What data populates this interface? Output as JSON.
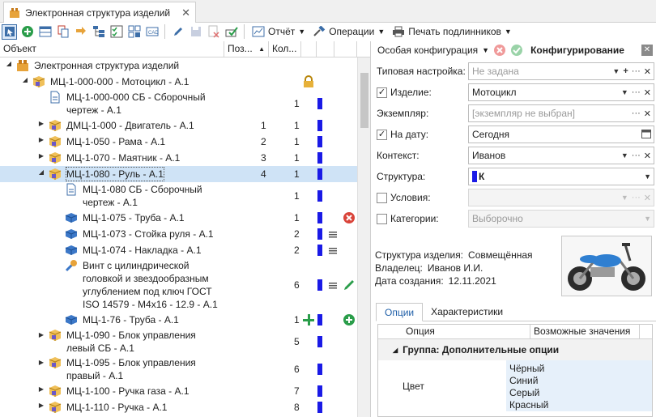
{
  "tab": {
    "title": "Электронная структура изделий",
    "close": "✕"
  },
  "toolbar": {
    "report": "Отчёт",
    "operations": "Операции",
    "print": "Печать подлинников"
  },
  "grid": {
    "col_object": "Объект",
    "col_pos": "Поз...",
    "col_qty": "Кол...",
    "rows": [
      {
        "label": "Электронная структура изделий",
        "pos": "",
        "qty": "",
        "level": 0,
        "icon": "structure",
        "exp": "down"
      },
      {
        "label": "МЦ-1-000-000 - Мотоцикл - А.1",
        "pos": "",
        "qty": "",
        "level": 1,
        "icon": "assembly",
        "exp": "down",
        "lock": true
      },
      {
        "label": "МЦ-1-000-000 СБ - Сборочный\nчертеж - А.1",
        "pos": "",
        "qty": "1",
        "level": 2,
        "icon": "document",
        "bar": true
      },
      {
        "label": "ДМЦ-1-000 - Двигатель - А.1",
        "pos": "1",
        "qty": "1",
        "level": 2,
        "icon": "assembly",
        "exp": "right",
        "bar": true
      },
      {
        "label": "МЦ-1-050 - Рама - А.1",
        "pos": "2",
        "qty": "1",
        "level": 2,
        "icon": "assembly",
        "exp": "right",
        "bar": true
      },
      {
        "label": "МЦ-1-070 - Маятник - А.1",
        "pos": "3",
        "qty": "1",
        "level": 2,
        "icon": "assembly",
        "exp": "right",
        "bar": true
      },
      {
        "label": "МЦ-1-080 - Руль - А.1",
        "pos": "4",
        "qty": "1",
        "level": 2,
        "icon": "assembly",
        "exp": "down",
        "bar": true,
        "selected": true
      },
      {
        "label": "МЦ-1-080 СБ - Сборочный\nчертеж - А.1",
        "pos": "",
        "qty": "1",
        "level": 3,
        "icon": "document",
        "bar": true
      },
      {
        "label": "МЦ-1-075 - Труба - А.1",
        "pos": "",
        "qty": "1",
        "level": 3,
        "icon": "part",
        "bar": true,
        "status": "remove"
      },
      {
        "label": "МЦ-1-073 - Стойка руля - А.1",
        "pos": "",
        "qty": "2",
        "level": 3,
        "icon": "part",
        "bar": true,
        "status": "menu"
      },
      {
        "label": "МЦ-1-074 - Накладка - А.1",
        "pos": "",
        "qty": "2",
        "level": 3,
        "icon": "part",
        "bar": true,
        "status": "menu"
      },
      {
        "label": "Винт с цилиндрической\nголовкой и звездообразным\nуглублением под ключ ГОСТ\nISO 14579 - M4x16 - 12.9 - А.1",
        "pos": "",
        "qty": "6",
        "level": 3,
        "icon": "standard",
        "bar": true,
        "status": "menu-edit"
      },
      {
        "label": "МЦ-1-76 - Труба - А.1",
        "pos": "",
        "qty": "1",
        "level": 3,
        "icon": "part",
        "bar": true,
        "plus": true,
        "status": "add"
      },
      {
        "label": "МЦ-1-090 - Блок управления\nлевый СБ - А.1",
        "pos": "",
        "qty": "5",
        "level": 2,
        "icon": "assembly",
        "exp": "right",
        "bar": true
      },
      {
        "label": "МЦ-1-095 - Блок управления\nправый - А.1",
        "pos": "",
        "qty": "6",
        "level": 2,
        "icon": "assembly",
        "exp": "right",
        "bar": true
      },
      {
        "label": "МЦ-1-100 - Ручка газа - А.1",
        "pos": "",
        "qty": "7",
        "level": 2,
        "icon": "assembly",
        "exp": "right",
        "bar": true
      },
      {
        "label": "МЦ-1-110 - Ручка - А.1",
        "pos": "",
        "qty": "8",
        "level": 2,
        "icon": "assembly",
        "exp": "right",
        "bar": true
      }
    ]
  },
  "config": {
    "special": "Особая конфигурация",
    "title": "Конфигурирование",
    "fields": [
      {
        "label": "Типовая настройка:",
        "value": "Не задана",
        "placeholder": true,
        "check": null,
        "acts": "add"
      },
      {
        "label": "Изделие:",
        "value": "Мотоцикл",
        "placeholder": false,
        "check": true,
        "acts": "dd"
      },
      {
        "label": "Экземпляр:",
        "value": "[экземпляр не выбран]",
        "placeholder": true,
        "check": null,
        "acts": "dots"
      },
      {
        "label": "На дату:",
        "value": "Сегодня",
        "placeholder": false,
        "check": true,
        "acts": "cal"
      },
      {
        "label": "Контекст:",
        "value": "Иванов",
        "placeholder": false,
        "check": null,
        "acts": "dd"
      },
      {
        "label": "Структура:",
        "value": "К",
        "placeholder": false,
        "check": null,
        "acts": "only"
      },
      {
        "label": "Условия:",
        "value": "",
        "placeholder": true,
        "check": false,
        "acts": "dd",
        "disabled": true
      },
      {
        "label": "Категории:",
        "value": "Выборочно",
        "placeholder": true,
        "check": false,
        "acts": "only",
        "disabled": true
      }
    ],
    "info": {
      "structure_label": "Структура изделия:",
      "structure": "Совмещённая",
      "owner_label": "Владелец:",
      "owner": "Иванов И.И.",
      "created_label": "Дата создания:",
      "created": "12.11.2021"
    },
    "tabs": [
      "Опции",
      "Характеристики"
    ],
    "options": {
      "col_option": "Опция",
      "col_values": "Возможные значения",
      "group": "Группа: Дополнительные опции",
      "name": "Цвет",
      "values": [
        "Чёрный",
        "Синий",
        "Серый",
        "Красный"
      ]
    }
  },
  "colors": {
    "accent": "#1a1ae6",
    "selected": "#cfe3f6",
    "remove": "#d9443a",
    "add": "#2a9d4a"
  }
}
